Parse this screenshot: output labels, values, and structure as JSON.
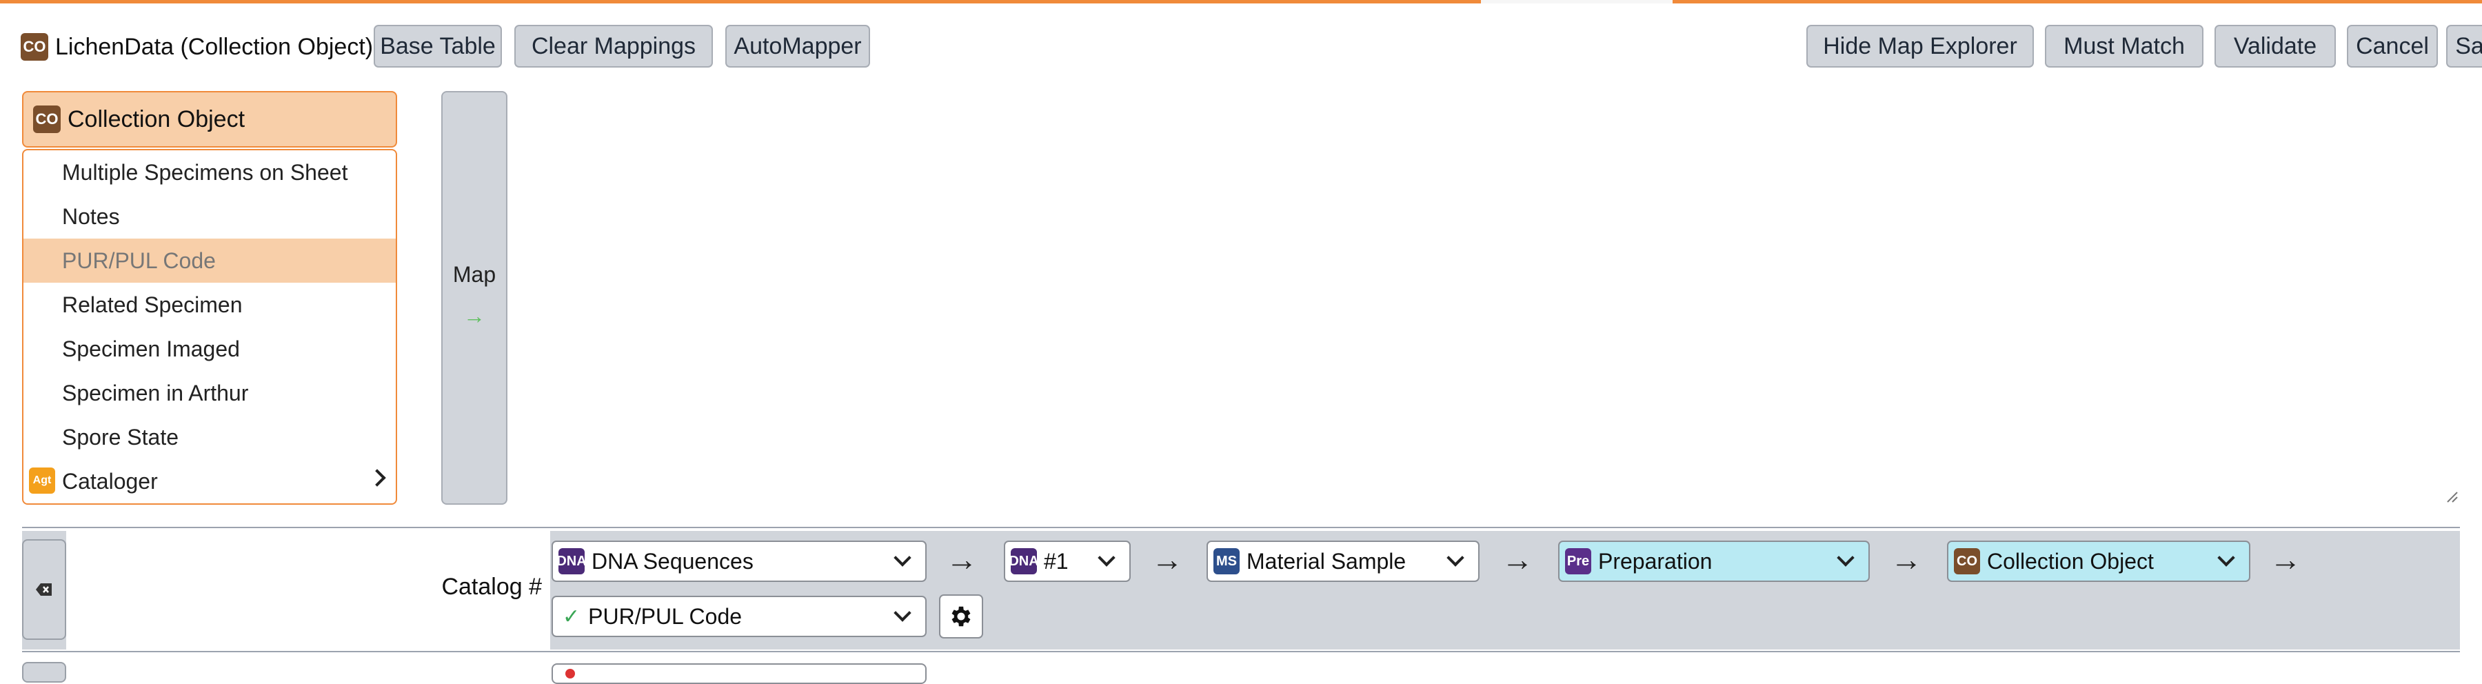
{
  "toolbar": {
    "dataset_title": "LichenData (Collection Object)",
    "title_icon": "co-table-icon",
    "buttons_left": [
      "Base Table",
      "Clear Mappings",
      "AutoMapper"
    ],
    "buttons_right": [
      "Hide Map Explorer",
      "Must Match",
      "Validate",
      "Cancel",
      "Save"
    ]
  },
  "picker": {
    "header": "Collection Object",
    "items": [
      "Multiple Specimens on Sheet",
      "Notes",
      "PUR/PUL Code",
      "Related Specimen",
      "Specimen Imaged",
      "Specimen in Arthur",
      "Spore State",
      "Cataloger"
    ],
    "selected_item": "PUR/PUL Code",
    "badges": {
      "co": "CO",
      "agt": "Agt",
      "dna": "DNA",
      "ms": "MS",
      "pre": "Pre"
    }
  },
  "map_button": {
    "label": "Map",
    "arrow": "→"
  },
  "mapping_row": {
    "header": "Catalog #",
    "path": [
      "DNA Sequences",
      "#1",
      "Material Sample",
      "Preparation",
      "Collection Object"
    ],
    "field": "PUR/PUL Code",
    "field_check": "✓",
    "arrow": "→"
  },
  "colors": {
    "accent_orange": "#f08a3a",
    "selected_bg": "#f8cfa9",
    "button_gray": "#d1d5db",
    "highlight_cyan": "#b9eaf3"
  }
}
